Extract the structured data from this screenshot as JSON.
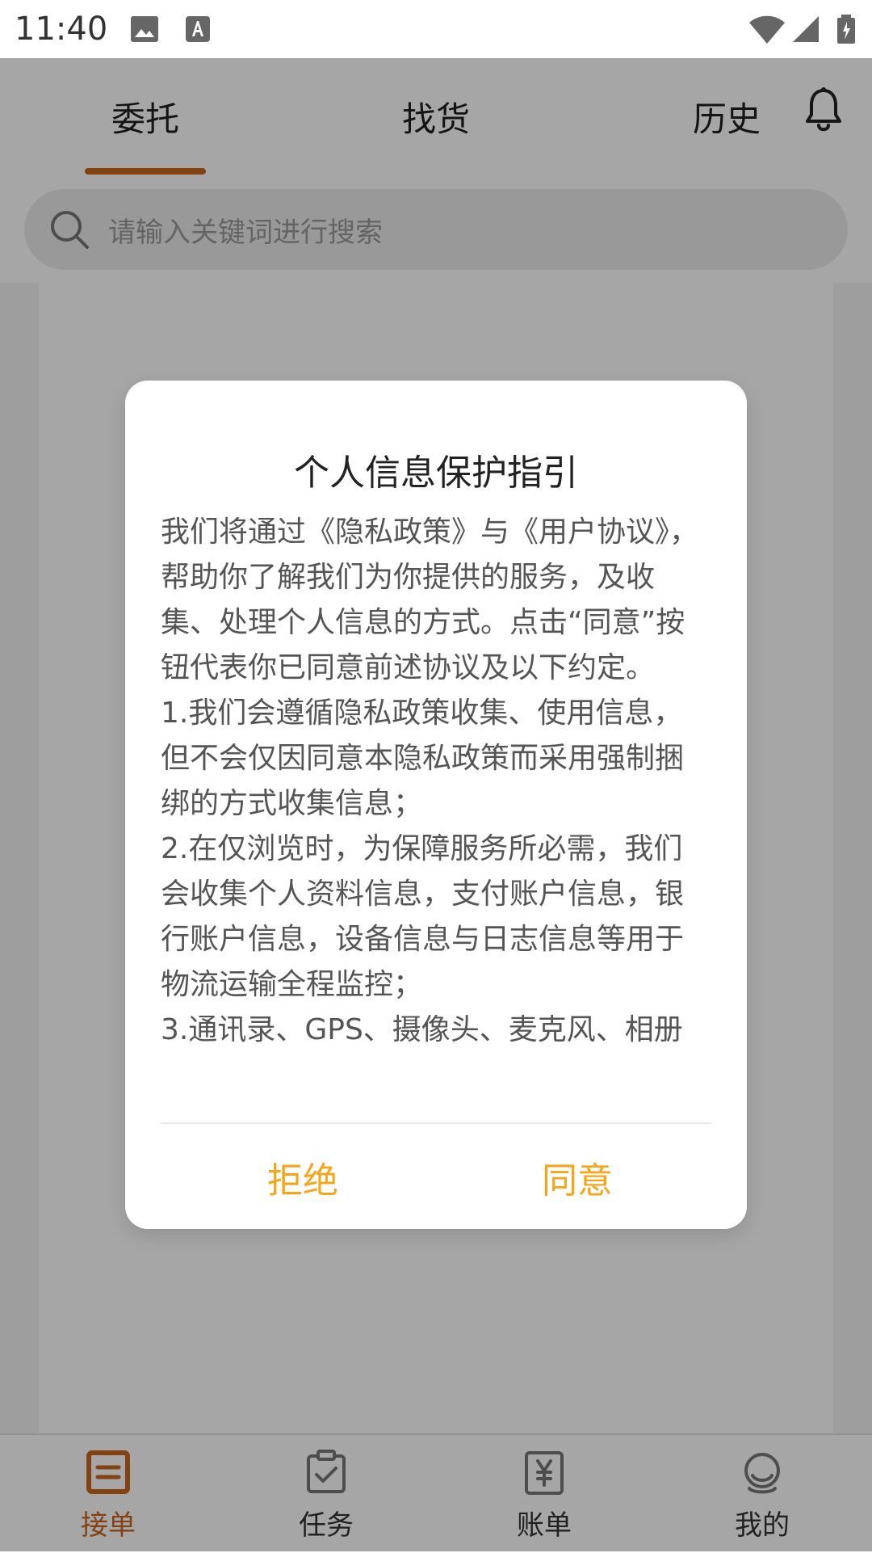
{
  "status_bar": {
    "time": "11:40"
  },
  "top_tabs": {
    "items": [
      "委托",
      "找货",
      "历史"
    ],
    "active": 0
  },
  "search": {
    "placeholder": "请输入关键词进行搜索"
  },
  "dialog": {
    "title": "个人信息保护指引",
    "body": "我们将通过《隐私政策》与《用户协议》，帮助你了解我们为你提供的服务，及收集、处理个人信息的方式。点击“同意”按钮代表你已同意前述协议及以下约定。\n1.我们会遵循隐私政策收集、使用信息，但不会仅因同意本隐私政策而采用强制捆绑的方式收集信息；\n2.在仅浏览时，为保障服务所必需，我们会收集个人资料信息，支付账户信息，银行账户信息，设备信息与日志信息等用于物流运输全程监控；\n3.通讯录、GPS、摄像头、麦克风、相册",
    "reject_label": "拒绝",
    "agree_label": "同意"
  },
  "bottom_nav": {
    "items": [
      {
        "label": "接单",
        "icon": "order-icon"
      },
      {
        "label": "任务",
        "icon": "task-icon"
      },
      {
        "label": "账单",
        "icon": "bill-icon"
      },
      {
        "label": "我的",
        "icon": "profile-icon"
      }
    ],
    "active": 0
  },
  "colors": {
    "accent": "#c8661b",
    "dialog_button": "#f4a51c"
  }
}
